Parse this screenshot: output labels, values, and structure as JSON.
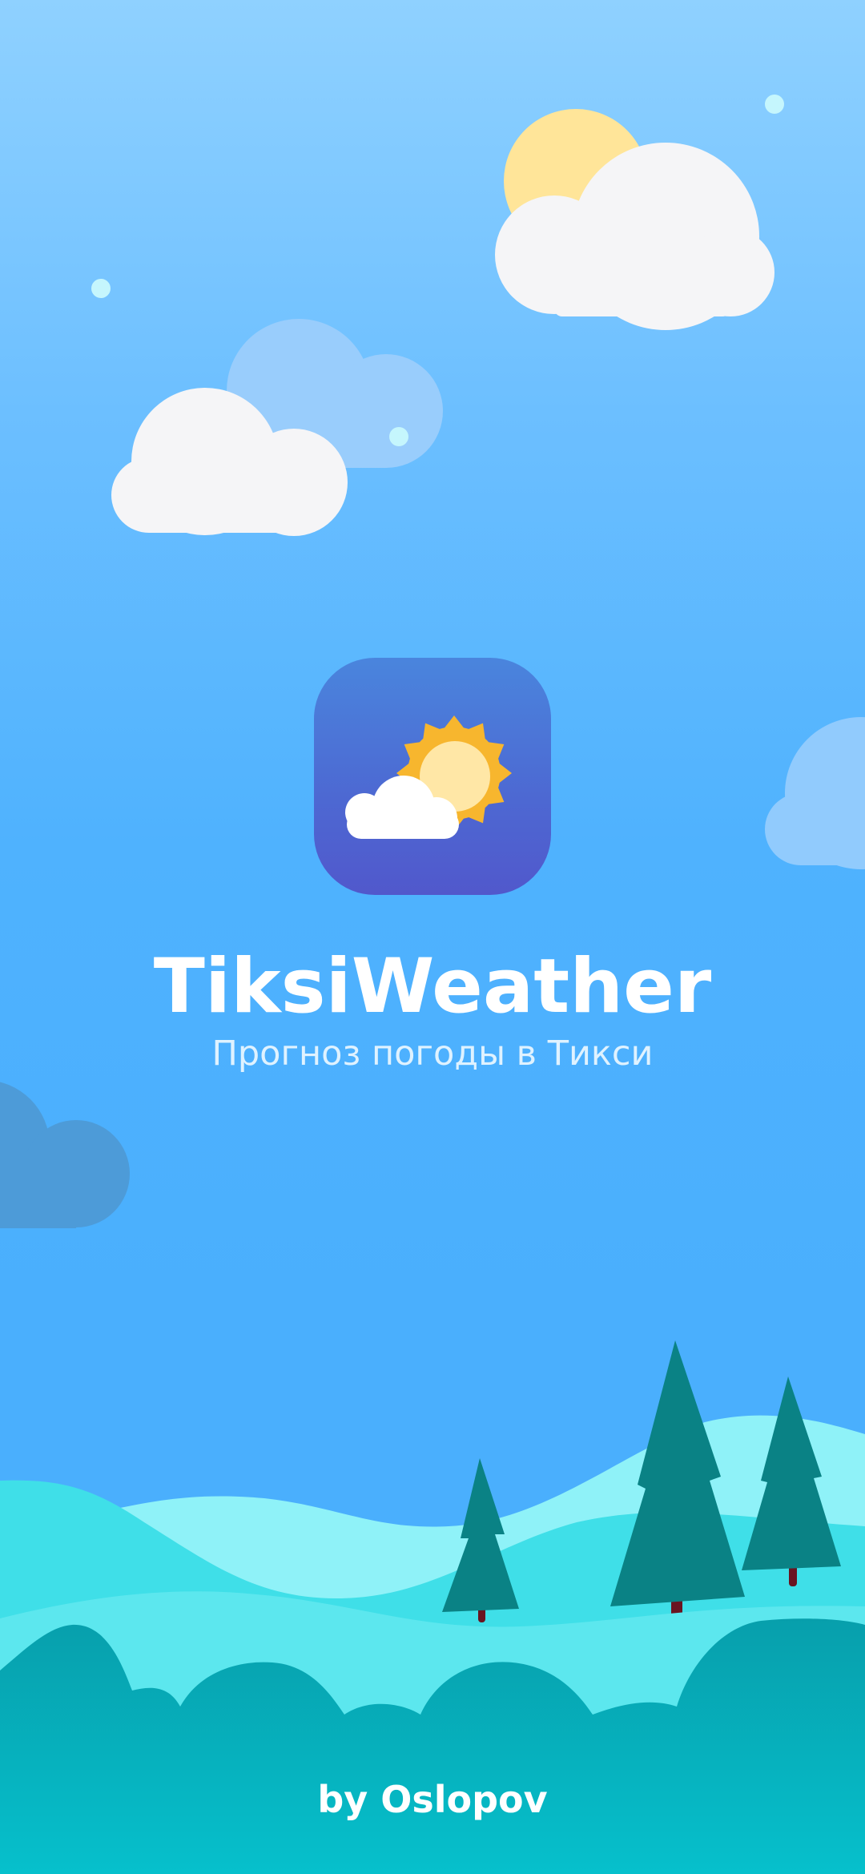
{
  "app": {
    "title": "TiksiWeather",
    "subtitle": "Прогноз погоды в Тикси",
    "author": "by Oslopov"
  },
  "icons": {
    "app_icon": "partly-cloudy-sun-icon"
  },
  "colors": {
    "sky_top": "#8fd1ff",
    "sky_bottom": "#4aaffd",
    "icon_bg_top": "#4a85dd",
    "icon_bg_bottom": "#5158cc",
    "sun": "#f7b62e",
    "cloud": "#f5f5f7",
    "hill_light": "#8ff2f8",
    "hill_mid": "#3fdfe8",
    "hill_dark": "#07aeb9",
    "tree": "#0a8285",
    "trunk": "#6a1420"
  }
}
